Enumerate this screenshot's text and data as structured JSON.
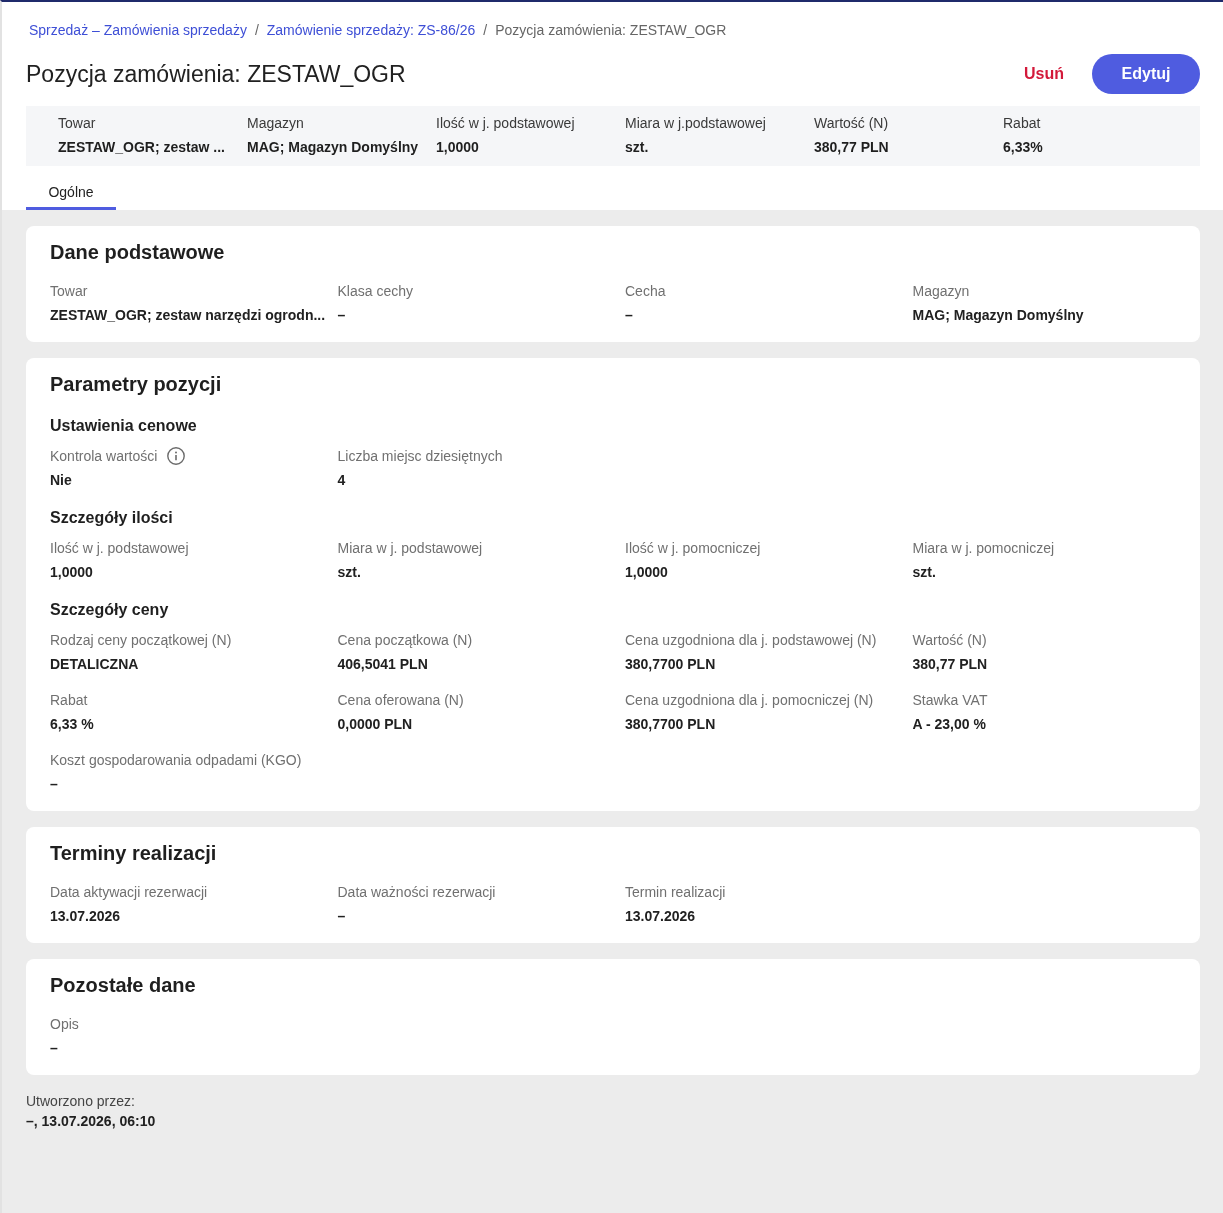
{
  "breadcrumbs": {
    "separator": "/",
    "items": [
      {
        "label": "Sprzedaż – Zamówienia sprzedaży",
        "kind": "link"
      },
      {
        "label": "Zamówienie sprzedaży: ZS-86/26",
        "kind": "link"
      },
      {
        "label": "Pozycja zamówienia: ZESTAW_OGR",
        "kind": "current"
      }
    ]
  },
  "title": "Pozycja zamówienia: ZESTAW_OGR",
  "actions": [
    {
      "label": "Usuń",
      "kind": "danger"
    },
    {
      "label": "Edytuj",
      "kind": "primary"
    }
  ],
  "summary": [
    {
      "label": "Towar",
      "value": "ZESTAW_OGR; zestaw ..."
    },
    {
      "label": "Magazyn",
      "value": "MAG; Magazyn Domyślny"
    },
    {
      "label": "Ilość w j. podstawowej",
      "value": "1,0000"
    },
    {
      "label": "Miara w j.podstawowej",
      "value": "szt."
    },
    {
      "label": "Wartość (N)",
      "value": "380,77 PLN"
    },
    {
      "label": "Rabat",
      "value": "6,33%"
    }
  ],
  "tabs": [
    {
      "label": "Ogólne",
      "selected": true
    }
  ],
  "sections": [
    {
      "title": "Dane podstawowe",
      "groups": [
        {
          "fields": [
            {
              "label": "Towar",
              "value": "ZESTAW_OGR; zestaw narzędzi ogrodn...",
              "info": false
            },
            {
              "label": "Klasa cechy",
              "value": "–",
              "info": false
            },
            {
              "label": "Cecha",
              "value": "–",
              "info": false
            },
            {
              "label": "Magazyn",
              "value": "MAG; Magazyn Domyślny",
              "info": false
            }
          ]
        }
      ]
    },
    {
      "title": "Parametry pozycji",
      "groups": [
        {
          "heading": "Ustawienia cenowe",
          "fields": [
            {
              "label": "Kontrola wartości",
              "value": "Nie",
              "info": true
            },
            {
              "label": "Liczba miejsc dziesiętnych",
              "value": "4",
              "info": false
            }
          ]
        },
        {
          "heading": "Szczegóły ilości",
          "fields": [
            {
              "label": "Ilość w j. podstawowej",
              "value": "1,0000",
              "info": false
            },
            {
              "label": "Miara w j. podstawowej",
              "value": "szt.",
              "info": false
            },
            {
              "label": "Ilość w j. pomocniczej",
              "value": "1,0000",
              "info": false
            },
            {
              "label": "Miara w j. pomocniczej",
              "value": "szt.",
              "info": false
            }
          ]
        },
        {
          "heading": "Szczegóły ceny",
          "fields": [
            {
              "label": "Rodzaj ceny początkowej (N)",
              "value": "DETALICZNA",
              "info": false
            },
            {
              "label": "Cena początkowa (N)",
              "value": "406,5041 PLN",
              "info": false
            },
            {
              "label": "Cena uzgodniona dla j. podstawowej (N)",
              "value": "380,7700 PLN",
              "info": false
            },
            {
              "label": "Wartość (N)",
              "value": "380,77 PLN",
              "info": false
            },
            {
              "label": "Rabat",
              "value": "6,33 %",
              "info": false
            },
            {
              "label": "Cena oferowana (N)",
              "value": "0,0000 PLN",
              "info": false
            },
            {
              "label": "Cena uzgodniona dla j. pomocniczej (N)",
              "value": "380,7700 PLN",
              "info": false
            },
            {
              "label": "Stawka VAT",
              "value": "A - 23,00 %",
              "info": false
            },
            {
              "label": "Koszt gospodarowania odpadami (KGO)",
              "value": "–",
              "info": false
            }
          ]
        }
      ]
    },
    {
      "title": "Terminy realizacji",
      "groups": [
        {
          "fields": [
            {
              "label": "Data aktywacji rezerwacji",
              "value": "13.07.2026",
              "info": false
            },
            {
              "label": "Data ważności rezerwacji",
              "value": "–",
              "info": false
            },
            {
              "label": "Termin realizacji",
              "value": "13.07.2026",
              "info": false
            }
          ]
        }
      ]
    },
    {
      "title": "Pozostałe dane",
      "groups": [
        {
          "fields": [
            {
              "label": "Opis",
              "value": "–",
              "info": false
            }
          ]
        }
      ]
    }
  ],
  "footer": {
    "label": "Utworzono przez:",
    "value": "–, 13.07.2026, 06:10"
  }
}
